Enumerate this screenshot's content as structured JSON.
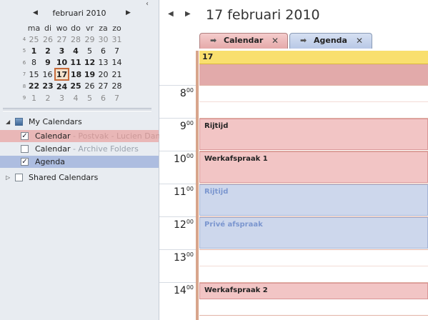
{
  "navigator": {
    "month_title": "februari 2010",
    "prev_icon": "◀",
    "next_icon": "▶",
    "collapse_icon": "‹",
    "weekdays": [
      "ma",
      "di",
      "wo",
      "do",
      "vr",
      "za",
      "zo"
    ],
    "weeks": [
      {
        "wk": "4",
        "days": [
          "25",
          "26",
          "27",
          "28",
          "29",
          "30",
          "31"
        ]
      },
      {
        "wk": "5",
        "days": [
          "1",
          "2",
          "3",
          "4",
          "5",
          "6",
          "7"
        ]
      },
      {
        "wk": "6",
        "days": [
          "8",
          "9",
          "10",
          "11",
          "12",
          "13",
          "14"
        ]
      },
      {
        "wk": "7",
        "days": [
          "15",
          "16",
          "17",
          "18",
          "19",
          "20",
          "21"
        ]
      },
      {
        "wk": "8",
        "days": [
          "22",
          "23",
          "24",
          "25",
          "26",
          "27",
          "28"
        ]
      },
      {
        "wk": "9",
        "days": [
          "1",
          "2",
          "3",
          "4",
          "5",
          "6",
          "7"
        ]
      }
    ]
  },
  "calendars": {
    "my_group": "My Calendars",
    "items": [
      {
        "name": "Calendar",
        "sub": " - Postvak - Lucien Dans",
        "checked": "✓"
      },
      {
        "name": "Calendar",
        "sub": " - Archive Folders",
        "checked": ""
      },
      {
        "name": "Agenda",
        "sub": "",
        "checked": "✓"
      }
    ],
    "shared_group": "Shared Calendars",
    "expand_open": "◢",
    "expand_closed": "▷"
  },
  "view": {
    "date_title": "17 februari 2010",
    "prev_icon": "◀",
    "next_icon": "▶",
    "tabs": [
      {
        "label": "Calendar",
        "arrow": "➡",
        "close": "✕"
      },
      {
        "label": "Agenda",
        "arrow": "➡",
        "close": "✕"
      }
    ],
    "day_number": "17",
    "hours": [
      {
        "h": "8",
        "m": "00"
      },
      {
        "h": "9",
        "m": "00"
      },
      {
        "h": "10",
        "m": "00"
      },
      {
        "h": "11",
        "m": "00"
      },
      {
        "h": "12",
        "m": "00"
      },
      {
        "h": "13",
        "m": "00"
      },
      {
        "h": "14",
        "m": "00"
      }
    ],
    "appointments": [
      {
        "title": "Rijtijd",
        "calendar": "Calendar"
      },
      {
        "title": "Werkafspraak 1",
        "calendar": "Calendar"
      },
      {
        "title": "Rijtijd",
        "calendar": "Agenda"
      },
      {
        "title": "Privé afspraak",
        "calendar": "Agenda"
      },
      {
        "title": "Werkafspraak 2",
        "calendar": "Calendar"
      }
    ]
  },
  "colors": {
    "calendar_red": "#f2c5c5",
    "agenda_blue": "#cdd7ec",
    "today_border": "#c56a3a",
    "allday_yellow": "#f9df6e"
  }
}
